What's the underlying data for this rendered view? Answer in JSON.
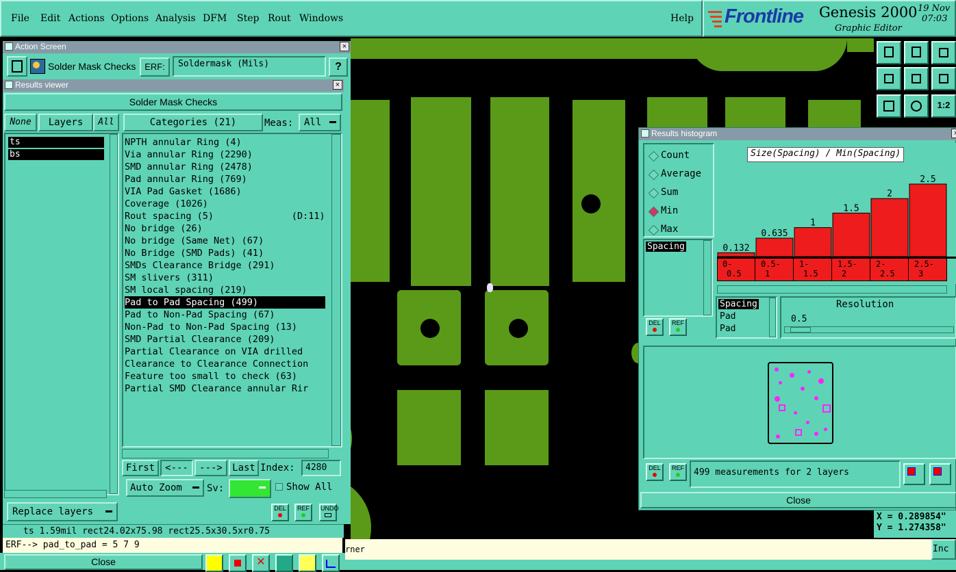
{
  "menu": {
    "items": [
      "File",
      "Edit",
      "Actions",
      "Options",
      "Analysis",
      "DFM",
      "Step",
      "Rout",
      "Windows"
    ],
    "help": "Help"
  },
  "brand": {
    "logo": "Frontline",
    "product": "Genesis 2000",
    "subtitle": "Graphic Editor",
    "date": "19 Nov",
    "time": "07:03"
  },
  "action_screen": {
    "title": "Action Screen",
    "name": "Solder Mask Checks",
    "erf_label": "ERF:",
    "erf_value": "Soldermask (Mils)",
    "help_btn": "?"
  },
  "results_viewer": {
    "title": "Results viewer",
    "header": "Solder Mask Checks",
    "none_btn": "None",
    "layers_btn": "Layers",
    "all_btn": "All",
    "categories_btn": "Categories (21)",
    "meas_label": "Meas:",
    "meas_value": "All",
    "layers": [
      "ts",
      "bs"
    ],
    "categories": [
      "NPTH annular Ring (4)",
      "Via annular Ring (2290)",
      "SMD annular Ring (2478)",
      "Pad annular Ring (769)",
      "VIA Pad Gasket (1686)",
      "Coverage (1026)",
      "Rout spacing (5)              (D:11)",
      "No bridge (26)",
      "No bridge (Same Net) (67)",
      "No Bridge (SMD Pads) (41)",
      "SMDs Clearance Bridge (291)",
      "SM slivers (311)",
      "SM local spacing (219)",
      "Pad to Pad Spacing (499)",
      "Pad to Non-Pad Spacing (67)",
      "Non-Pad to Non-Pad Spacing (13)",
      "SMD Partial Clearance (209)",
      "Partial Clearance on VIA drilled",
      "Clearance to Clearance Connection",
      "Feature too small to check (63)",
      "Partial SMD Clearance annular Rir"
    ],
    "selected_index": 13,
    "first_btn": "First",
    "prev_btn": "<---",
    "next_btn": "--->",
    "last_btn": "Last",
    "index_label": "Index:",
    "index_value": "4280",
    "auto_zoom": "Auto Zoom",
    "sv_label": "Sv:",
    "show_all": "Show All",
    "replace_layers": "Replace layers",
    "del": "DEL",
    "ref": "REF",
    "undo": "UNDO"
  },
  "status": {
    "line1": "ts 1.59mil  rect24.02x75.98  rect25.5x30.5xr0.75",
    "erf_line": "ERF--> pad_to_pad = 5 7 9",
    "close": "Close",
    "bottom_right": "rner",
    "bottom_far": "Inc"
  },
  "histogram": {
    "title": "Results histogram",
    "modes": [
      "Count",
      "Average",
      "Sum",
      "Min",
      "Max"
    ],
    "selected_mode": "Min",
    "chart_title": "Size(Spacing) / Min(Spacing)",
    "bar_values": [
      "0.132",
      "0.635",
      "1",
      "1.5",
      "2",
      "2.5"
    ],
    "bar_heights": [
      0.132,
      0.635,
      1,
      1.5,
      2,
      2.5
    ],
    "bin_labels_top": [
      "0-",
      "0.5-",
      "1-",
      "1.5-",
      "2-",
      "2.5-"
    ],
    "bin_labels_bottom": [
      "0.5",
      "1",
      "1.5",
      "2",
      "2.5",
      "3"
    ],
    "list1": [
      "Spacing"
    ],
    "list2": [
      "Spacing",
      "Pad",
      "Pad"
    ],
    "resolution_label": "Resolution",
    "resolution_value": "0.5",
    "measurements": "499 measurements for 2 layers",
    "close": "Close",
    "del": "DEL",
    "ref": "REF"
  },
  "coords": {
    "x": "X = 0.289854\"",
    "y": "Y = 1.274358\""
  },
  "toolbar_labels": {
    "one_two": "1:2"
  }
}
